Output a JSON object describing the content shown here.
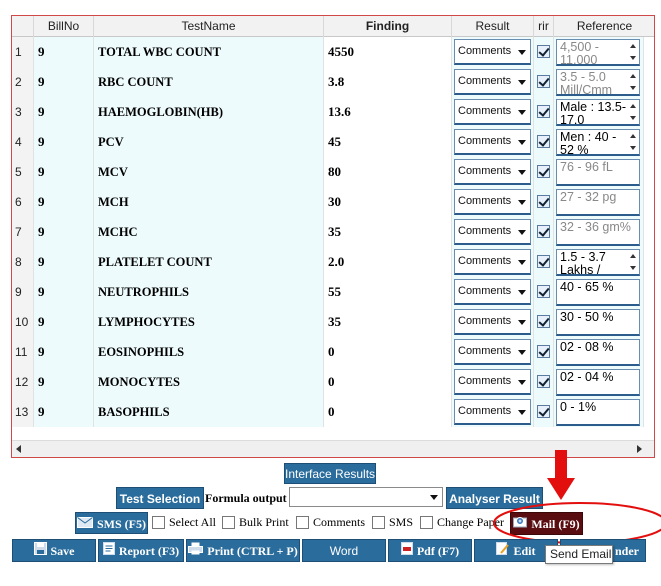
{
  "grid": {
    "headers": [
      "BillNo",
      "TestName",
      "Finding",
      "Result",
      "rir",
      "Reference"
    ],
    "rows": [
      {
        "num": "1",
        "bill": "9",
        "test": "TOTAL WBC COUNT",
        "finding": "4550",
        "result": "Comments",
        "ref": "4,500 - 11,000"
      },
      {
        "num": "2",
        "bill": "9",
        "test": "RBC COUNT",
        "finding": "3.8",
        "result": "Comments",
        "ref": "3.5 - 5.0 Mill/Cmm"
      },
      {
        "num": "3",
        "bill": "9",
        "test": "HAEMOGLOBIN(HB)",
        "finding": "13.6",
        "result": "Comments",
        "ref": "Male : 13.5-17.0"
      },
      {
        "num": "4",
        "bill": "9",
        "test": "PCV",
        "finding": "45",
        "result": "Comments",
        "ref": "Men : 40 - 52 %"
      },
      {
        "num": "5",
        "bill": "9",
        "test": "MCV",
        "finding": "80",
        "result": "Comments",
        "ref": "76 - 96 fL"
      },
      {
        "num": "6",
        "bill": "9",
        "test": "MCH",
        "finding": "30",
        "result": "Comments",
        "ref": "27 - 32 pg"
      },
      {
        "num": "7",
        "bill": "9",
        "test": "MCHC",
        "finding": "35",
        "result": "Comments",
        "ref": "32 - 36 gm%"
      },
      {
        "num": "8",
        "bill": "9",
        "test": "PLATELET COUNT",
        "finding": "2.0",
        "result": "Comments",
        "ref": "1.5 - 3.7 Lakhs /"
      },
      {
        "num": "9",
        "bill": "9",
        "test": "NEUTROPHILS",
        "finding": "55",
        "result": "Comments",
        "ref": "40 - 65 %"
      },
      {
        "num": "10",
        "bill": "9",
        "test": "LYMPHOCYTES",
        "finding": "35",
        "result": "Comments",
        "ref": "30 - 50 %"
      },
      {
        "num": "11",
        "bill": "9",
        "test": "EOSINOPHILS",
        "finding": "0",
        "result": "Comments",
        "ref": "02 - 08 %"
      },
      {
        "num": "12",
        "bill": "9",
        "test": "MONOCYTES",
        "finding": "0",
        "result": "Comments",
        "ref": "02 - 04 %"
      },
      {
        "num": "13",
        "bill": "9",
        "test": "BASOPHILS",
        "finding": "0",
        "result": "Comments",
        "ref": "0 - 1%"
      }
    ]
  },
  "controls": {
    "interface_results": "Interface Results",
    "test_selection": "Test Selection",
    "formula_output": "Formula output",
    "analyser_result": "Analyser Result",
    "sms_button": "SMS (F5)",
    "select_all": "Select All",
    "bulk_print": "Bulk Print",
    "comments": "Comments",
    "sms": "SMS",
    "change_paper": "Change Paper",
    "mail_button": "Mail (F9)"
  },
  "bottom_bar": {
    "save": "Save",
    "report": "Report (F3)",
    "print": "Print (CTRL + P)",
    "word": "Word",
    "pdf": "Pdf (F7)",
    "edit": "Edit",
    "reminder": "nder"
  },
  "tooltip": "Send Email",
  "colors": {
    "button": "#2a6c9c",
    "mail_button": "#5a0d10",
    "annotation": "#e30f0f",
    "grid_border": "#d04848"
  }
}
